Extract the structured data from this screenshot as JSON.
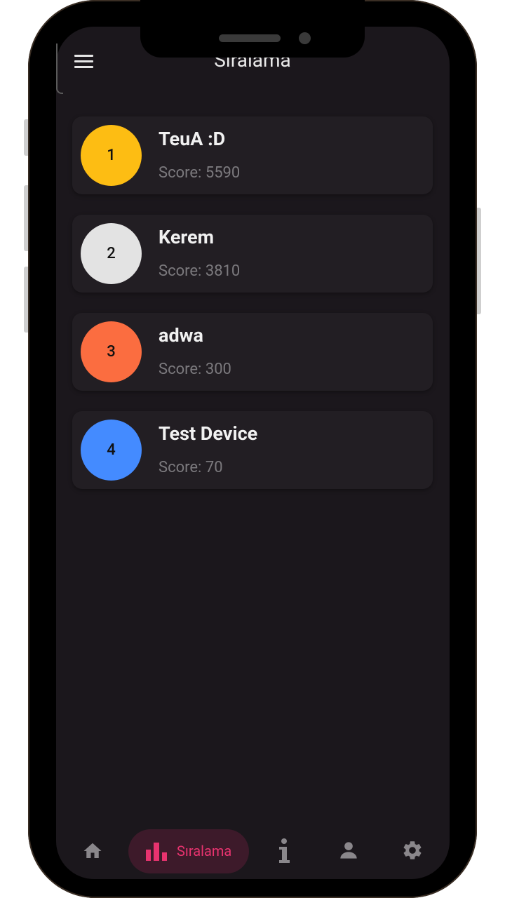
{
  "app_bar": {
    "title": "Sıralama",
    "menu_icon": "hamburger-menu-icon"
  },
  "leaderboard": [
    {
      "rank": "1",
      "name": "TeuA :D",
      "score": "Score: 5590",
      "color": "#fdbd13"
    },
    {
      "rank": "2",
      "name": "Kerem",
      "score": "Score: 3810",
      "color": "#e3e3e3"
    },
    {
      "rank": "3",
      "name": "adwa",
      "score": "Score: 300",
      "color": "#fb6d40"
    },
    {
      "rank": "4",
      "name": "Test Device",
      "score": "Score: 70",
      "color": "#448bff"
    }
  ],
  "bottom_nav": {
    "items": [
      {
        "icon": "home-icon",
        "label": "",
        "active": false
      },
      {
        "icon": "bar-chart-icon",
        "label": "Sıralama",
        "active": true
      },
      {
        "icon": "info-icon",
        "label": "",
        "active": false
      },
      {
        "icon": "person-icon",
        "label": "",
        "active": false
      },
      {
        "icon": "gear-icon",
        "label": "",
        "active": false
      }
    ],
    "active_color": "#e8336f",
    "inactive_color": "#8a878b"
  },
  "colors": {
    "background": "#1b171c",
    "card": "#221e23",
    "accent": "#e8336f"
  }
}
